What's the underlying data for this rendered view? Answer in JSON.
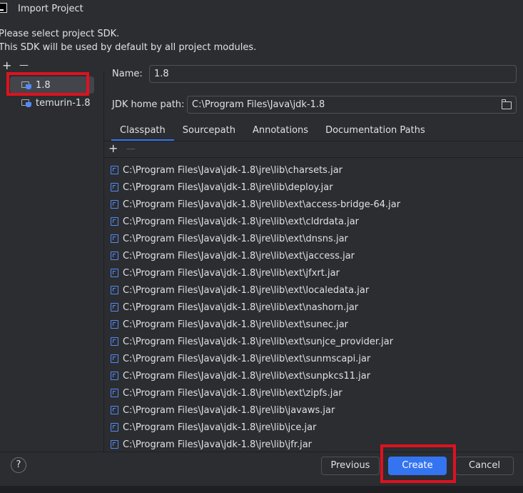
{
  "window": {
    "title": "Import Project"
  },
  "description": {
    "line1": "Please select project SDK.",
    "line2": "This SDK will be used by default by all project modules."
  },
  "toolbar": {
    "add": "+",
    "remove": "—"
  },
  "sdks": [
    {
      "label": "1.8",
      "selected": true
    },
    {
      "label": "temurin-1.8",
      "selected": false
    }
  ],
  "form": {
    "name_label": "Name:",
    "name_value": "1.8",
    "home_label": "JDK home path:",
    "home_value": "C:\\Program Files\\Java\\jdk-1.8"
  },
  "tabs": [
    {
      "label": "Classpath",
      "active": true
    },
    {
      "label": "Sourcepath",
      "active": false
    },
    {
      "label": "Annotations",
      "active": false
    },
    {
      "label": "Documentation Paths",
      "active": false
    }
  ],
  "classpath": [
    "C:\\Program Files\\Java\\jdk-1.8\\jre\\lib\\charsets.jar",
    "C:\\Program Files\\Java\\jdk-1.8\\jre\\lib\\deploy.jar",
    "C:\\Program Files\\Java\\jdk-1.8\\jre\\lib\\ext\\access-bridge-64.jar",
    "C:\\Program Files\\Java\\jdk-1.8\\jre\\lib\\ext\\cldrdata.jar",
    "C:\\Program Files\\Java\\jdk-1.8\\jre\\lib\\ext\\dnsns.jar",
    "C:\\Program Files\\Java\\jdk-1.8\\jre\\lib\\ext\\jaccess.jar",
    "C:\\Program Files\\Java\\jdk-1.8\\jre\\lib\\ext\\jfxrt.jar",
    "C:\\Program Files\\Java\\jdk-1.8\\jre\\lib\\ext\\localedata.jar",
    "C:\\Program Files\\Java\\jdk-1.8\\jre\\lib\\ext\\nashorn.jar",
    "C:\\Program Files\\Java\\jdk-1.8\\jre\\lib\\ext\\sunec.jar",
    "C:\\Program Files\\Java\\jdk-1.8\\jre\\lib\\ext\\sunjce_provider.jar",
    "C:\\Program Files\\Java\\jdk-1.8\\jre\\lib\\ext\\sunmscapi.jar",
    "C:\\Program Files\\Java\\jdk-1.8\\jre\\lib\\ext\\sunpkcs11.jar",
    "C:\\Program Files\\Java\\jdk-1.8\\jre\\lib\\ext\\zipfs.jar",
    "C:\\Program Files\\Java\\jdk-1.8\\jre\\lib\\javaws.jar",
    "C:\\Program Files\\Java\\jdk-1.8\\jre\\lib\\jce.jar",
    "C:\\Program Files\\Java\\jdk-1.8\\jre\\lib\\jfr.jar"
  ],
  "buttons": {
    "help": "?",
    "previous": "Previous",
    "create": "Create",
    "cancel": "Cancel"
  },
  "colors": {
    "background": "#2b2d30",
    "accent": "#3574f0",
    "highlight_box": "#e0111f"
  }
}
